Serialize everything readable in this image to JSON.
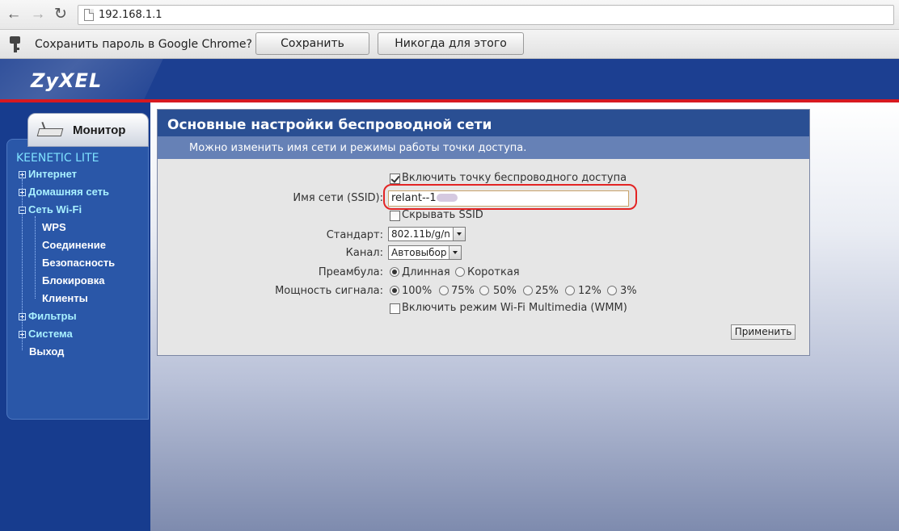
{
  "browser": {
    "url": "192.168.1.1",
    "infobar_text": "Сохранить пароль в Google Chrome?",
    "save_password_label": "Сохранить пароль",
    "never_for_site_label": "Никогда для этого сайта"
  },
  "header": {
    "logo": "ZyXEL"
  },
  "sidebar": {
    "tab_label": "Монитор",
    "model": "KEENETIC LITE",
    "menu": {
      "internet": "Интернет",
      "home_network": "Домашняя сеть",
      "wifi": "Сеть Wi-Fi",
      "wps": "WPS",
      "connection": "Соединение",
      "security": "Безопасность",
      "blocking": "Блокировка",
      "clients": "Клиенты",
      "filters": "Фильтры",
      "system": "Система",
      "logout": "Выход"
    }
  },
  "panel": {
    "title": "Основные настройки беспроводной сети",
    "subtitle": "Можно изменить имя сети и режимы работы точки доступа.",
    "enable_ap_label": "Включить точку беспроводного доступа",
    "enable_ap_checked": true,
    "ssid_label": "Имя сети (SSID):",
    "ssid_value": "relant--1",
    "hide_ssid_label": "Скрывать SSID",
    "hide_ssid_checked": false,
    "standard_label": "Стандарт:",
    "standard_value": "802.11b/g/n",
    "channel_label": "Канал:",
    "channel_value": "Автовыбор",
    "preamble_label": "Преамбула:",
    "preamble_long": "Длинная",
    "preamble_short": "Короткая",
    "preamble_selected": "Длинная",
    "power_label": "Мощность сигнала:",
    "power_options": [
      "100%",
      "75%",
      "50%",
      "25%",
      "12%",
      "3%"
    ],
    "power_selected": "100%",
    "wmm_label": "Включить режим Wi-Fi Multimedia (WMM)",
    "wmm_checked": false,
    "apply_label": "Применить"
  },
  "colors": {
    "header_blue": "#1c3f91",
    "accent_red": "#d71920",
    "panel_title_bg": "#2a4f93",
    "panel_sub_bg": "#6681b6",
    "menu_top_color": "#a8f0ff"
  }
}
